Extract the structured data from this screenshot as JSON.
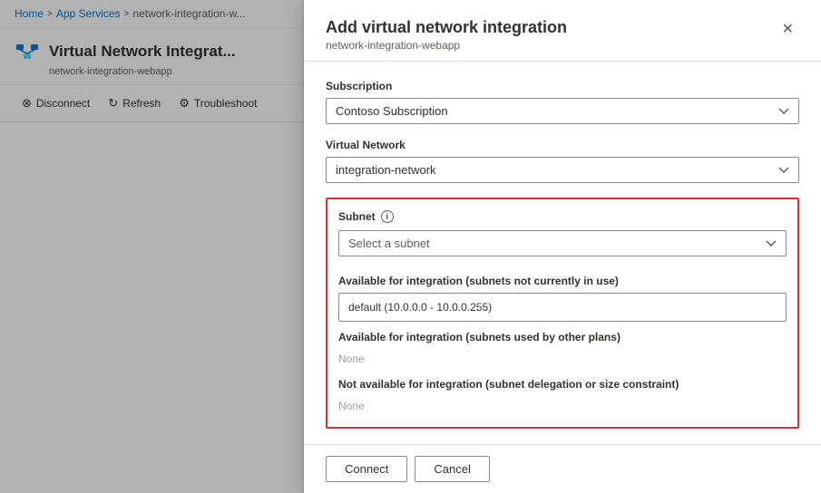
{
  "breadcrumb": {
    "home": "Home",
    "app_services": "App Services",
    "webapp": "network-integration-w...",
    "sep1": ">",
    "sep2": ">"
  },
  "left_panel": {
    "title": "Virtual Network Integrat...",
    "subtitle": "network-integration-webapp",
    "toolbar": {
      "disconnect_label": "Disconnect",
      "refresh_label": "Refresh",
      "troubleshoot_label": "Troubleshoot"
    }
  },
  "dialog": {
    "title": "Add virtual network integration",
    "subtitle": "network-integration-webapp",
    "close_icon": "✕",
    "subscription_label": "Subscription",
    "subscription_value": "Contoso Subscription",
    "vnet_label": "Virtual Network",
    "vnet_value": "integration-network",
    "subnet_label": "Subnet",
    "subnet_info": "i",
    "subnet_placeholder": "Select a subnet",
    "available_section1": "Available for integration (subnets not currently in use)",
    "subnet_item": "default (10.0.0.0 - 10.0.0.255)",
    "available_section2": "Available for integration (subnets used by other plans)",
    "none_label1": "None",
    "not_available_section": "Not available for integration (subnet delegation or size constraint)",
    "none_label2": "None",
    "connect_label": "Connect",
    "cancel_label": "Cancel"
  }
}
